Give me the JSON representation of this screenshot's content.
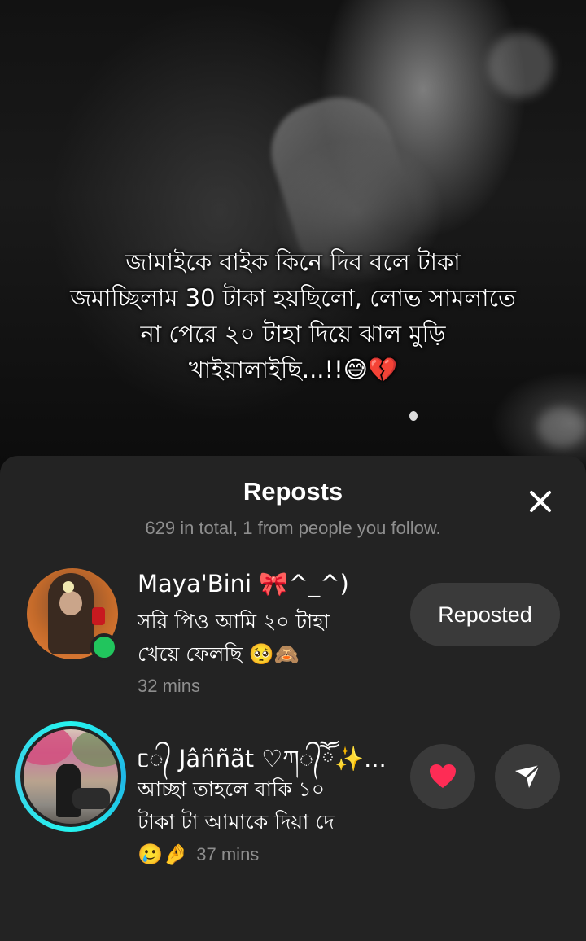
{
  "video": {
    "caption": "জামাইকে বাইক কিনে দিব বলে টাকা\nজমাচ্ছিলাম 30 টাকা হয়ছিলো, লোভ সামলাতে\nনা পেরে ২০  টাহা দিয়ে ঝাল মুড়ি\nখাইয়ালাইছি...!!😅💔"
  },
  "sheet": {
    "title": "Reposts",
    "subtitle": "629 in total, 1 from people you follow.",
    "close_icon": "close-icon"
  },
  "reposts": [
    {
      "username": "Maya'Bini 🎀^_^)",
      "comment": "সরি পিও আমি ২০ টাহা\nখেয়ে ফেলছি 🥺🙈",
      "time": "32 mins",
      "online": true,
      "online_color": "#21c55d",
      "action_label": "Reposted"
    },
    {
      "username": "ᥴ᭄ Jâññãt ♡ཀ᭄ཽ✨...",
      "comment": "আচ্ছা তাহলে বাকি ১০\nটাকা টা আমাকে দিয়া দে",
      "comment_tail": "🥲🤌",
      "time": "37 mins",
      "story_ring_color": "#25f4ee",
      "like_icon": "heart-icon",
      "send_icon": "send-icon",
      "like_color": "#fe2c55"
    }
  ]
}
